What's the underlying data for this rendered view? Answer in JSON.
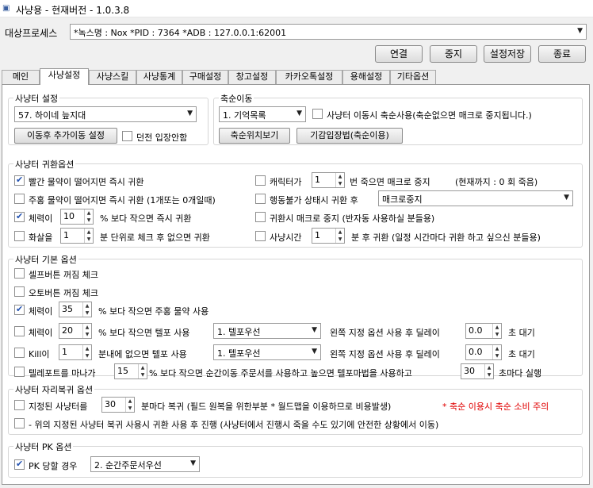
{
  "window": {
    "title": "사냥용 - 현재버전 - 1.0.3.8",
    "icon": "app-icon"
  },
  "device": {
    "label": "대상프로세스",
    "value": "*녹스명 : Nox *PID : 7364 *ADB : 127.0.0.1:62001"
  },
  "buttons": {
    "connect": "연결",
    "stop": "중지",
    "save": "설정저장",
    "exit": "종료"
  },
  "tabs": [
    "메인",
    "사냥설정",
    "사냥스킬",
    "사냥통계",
    "구매설정",
    "창고설정",
    "카카오톡설정",
    "용해설정",
    "기타옵션"
  ],
  "hunt_area": {
    "title": "사냥터 설정",
    "map": "57. 하이네 늪지대",
    "move_btn": "이동후 추가이동 설정",
    "dungeon_label": "던전 입장안함"
  },
  "scroll_move": {
    "title": "축순이동",
    "mode": "1. 기억목록",
    "use_label": "사냥터 이동시 축순사용(축순없으면 매크로 중지됩니다.)",
    "view_btn": "축순위치보기",
    "enter_btn": "기감입장법(축순이용)"
  },
  "return": {
    "title": "사냥터 귀환옵션",
    "red_potion": "빨간 물약이 떨어지면 즉시 귀환",
    "orange_potion": "주홍 물약이 떨어지면 즉시 귀환 (1개또는 0개일때)",
    "hp_val": "10",
    "hp_label": "% 보다 작으면 즉시 귀환",
    "hp_prefix": "체력이",
    "arrow_prefix": "화살을",
    "arrow_val": "1",
    "arrow_label": "분 단위로 체크 후 없으면 귀환",
    "death_prefix": "캐릭터가",
    "death_val": "1",
    "death_label": "번 죽으면 매크로 중지",
    "death_now": "(현재까지 : 0 회 죽음)",
    "paralysis_label": "행동불가 상태시 귀환 후",
    "paralysis_sel": "매크로중지",
    "return_stop": "귀환시 매크로 중지 (반자동 사용하실 분들용)",
    "time_prefix": "사냥시간",
    "time_val": "1",
    "time_label": "분 후 귀환 (일정 시간마다 귀환 하고 싶으신 분들용)"
  },
  "basic": {
    "title": "사냥터 기본 옵션",
    "self_btn": "셀프버튼 꺼짐 체크",
    "auto_btn": "오토버튼 꺼짐 체크",
    "hp1_prefix": "체력이",
    "hp1_val": "35",
    "hp1_label": "% 보다 작으면 주홍 물약 사용",
    "hp2_prefix": "체력이",
    "hp2_val": "20",
    "hp2_label": "% 보다 작으면 텔포 사용",
    "hp2_sel": "1. 텔포우선",
    "hp2_delay_label": "왼쪽 지정 옵션 사용 후 딜레이",
    "hp2_delay": "0.0",
    "sec": "초 대기",
    "kill_prefix": "Kill이",
    "kill_val": "1",
    "kill_label": "분내에 없으면 텔포 사용",
    "kill_sel": "1. 텔포우선",
    "kill_delay_label": "왼쪽 지정 옵션 사용 후 딜레이",
    "kill_delay": "0.0",
    "tele_label": "텔레포트를 마나가",
    "tele_val": "15",
    "tele_label2": "% 보다 작으면 순간이동 주문서를 사용하고 높으면 텔포마법을 사용하고",
    "tele_sec": "30",
    "tele_sec_label": "초마다 실행"
  },
  "recover": {
    "title": "사냥터 자리복귀 옵션",
    "prefix": "지정된 사냥터를",
    "val": "30",
    "label": "분마다 복귀 (필드 원복을 위한부분 * 월드맵을 이용하므로 비용발생)",
    "warn": "* 축순 이용시 축순 소비 주의",
    "line2": "- 위의 지정된 사냥터 복귀 사용시 귀환 사용 후 진행 (사냥터에서 진행시 죽을 수도 있기에 안전한 상황에서 이동)"
  },
  "pk": {
    "title": "사냥터 PK 옵션",
    "label": "PK 당할 경우",
    "sel": "2. 순간주문서우선"
  }
}
